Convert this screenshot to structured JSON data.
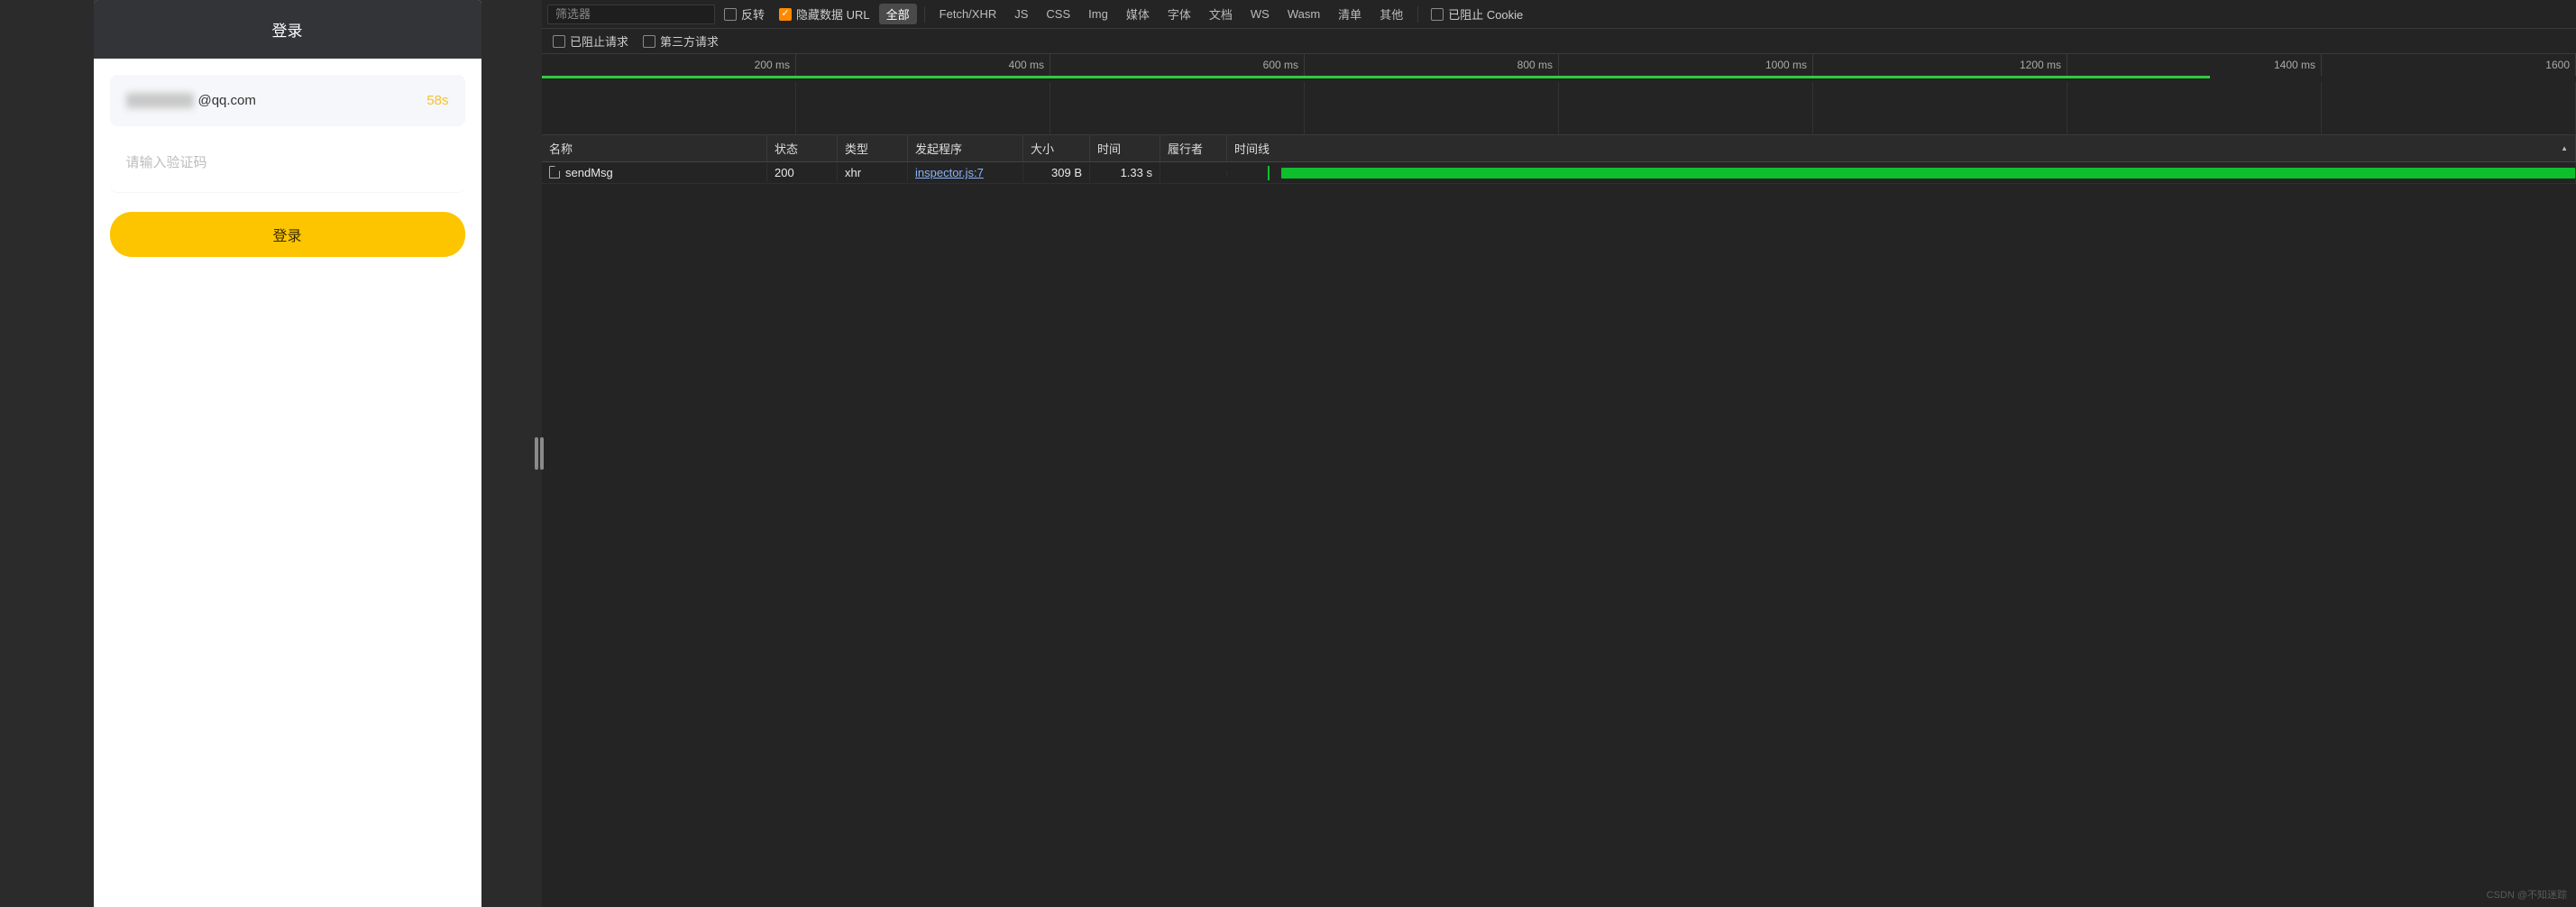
{
  "mobile": {
    "title": "登录",
    "email_masked_prefix": "········",
    "email_domain": "@qq.com",
    "timer": "58s",
    "code_placeholder": "请输入验证码",
    "login_button": "登录"
  },
  "devtools": {
    "filter_placeholder": "筛选器",
    "invert_label": "反转",
    "hide_data_urls_label": "隐藏数据 URL",
    "blocked_cookie_label": "已阻止 Cookie",
    "type_filters": {
      "all": "全部",
      "fetch": "Fetch/XHR",
      "js": "JS",
      "css": "CSS",
      "img": "Img",
      "media": "媒体",
      "font": "字体",
      "doc": "文档",
      "ws": "WS",
      "wasm": "Wasm",
      "manifest": "清单",
      "other": "其他"
    },
    "blocked_requests_label": "已阻止请求",
    "third_party_label": "第三方请求",
    "timeline_ticks": [
      "200 ms",
      "400 ms",
      "600 ms",
      "800 ms",
      "1000 ms",
      "1200 ms",
      "1400 ms",
      "1600"
    ],
    "overview_green_width_pct": 82,
    "columns": {
      "name": "名称",
      "status": "状态",
      "type": "类型",
      "initiator": "发起程序",
      "size": "大小",
      "time": "时间",
      "fulfilled_by": "履行者",
      "waterfall": "时间线"
    },
    "rows": [
      {
        "name": "sendMsg",
        "status": "200",
        "type": "xhr",
        "initiator": "inspector.js:7",
        "size": "309 B",
        "time": "1.33 s",
        "fulfilled_by": "",
        "bar_start_pct": 3,
        "bar_width_pct": 96
      }
    ]
  },
  "watermark": "CSDN @不知迷踪"
}
